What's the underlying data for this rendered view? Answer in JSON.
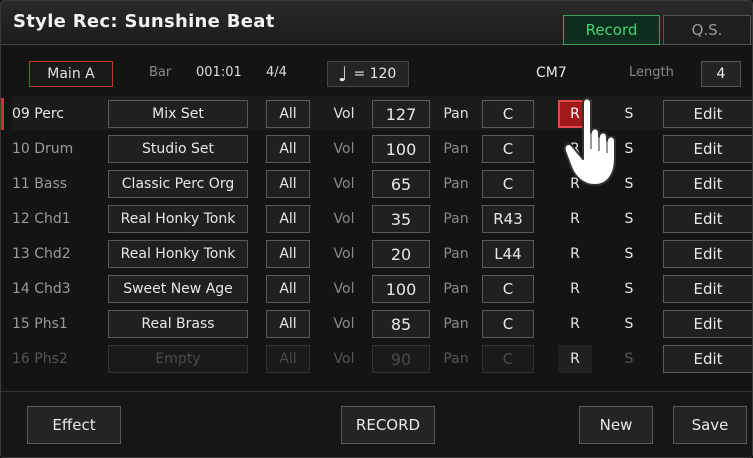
{
  "header": {
    "title": "Style Rec: Sunshine Beat",
    "tabs": [
      {
        "label": "Record",
        "active": true
      },
      {
        "label": "Q.S.",
        "active": false
      }
    ]
  },
  "info": {
    "section": "Main A",
    "bar_label": "Bar",
    "bar_value": "001:01",
    "time_signature": "4/4",
    "tempo_icon": "quarter-note-icon",
    "tempo_text": "= 120",
    "chord": "CM7",
    "length_label": "Length",
    "length_value": "4"
  },
  "tracks": [
    {
      "name": "09 Perc",
      "voice": "Mix Set",
      "all": "All",
      "vol_label": "Vol",
      "vol": "127",
      "pan_label": "Pan",
      "pan": "C",
      "r": "R",
      "s": "S",
      "edit": "Edit"
    },
    {
      "name": "10 Drum",
      "voice": "Studio Set",
      "all": "All",
      "vol_label": "Vol",
      "vol": "100",
      "pan_label": "Pan",
      "pan": "C",
      "r": "R",
      "s": "S",
      "edit": "Edit"
    },
    {
      "name": "11 Bass",
      "voice": "Classic Perc Org",
      "all": "All",
      "vol_label": "Vol",
      "vol": "65",
      "pan_label": "Pan",
      "pan": "C",
      "r": "R",
      "s": "S",
      "edit": "Edit"
    },
    {
      "name": "12 Chd1",
      "voice": "Real Honky Tonk",
      "all": "All",
      "vol_label": "Vol",
      "vol": "35",
      "pan_label": "Pan",
      "pan": "R43",
      "r": "R",
      "s": "S",
      "edit": "Edit"
    },
    {
      "name": "13 Chd2",
      "voice": "Real Honky Tonk",
      "all": "All",
      "vol_label": "Vol",
      "vol": "20",
      "pan_label": "Pan",
      "pan": "L44",
      "r": "R",
      "s": "S",
      "edit": "Edit"
    },
    {
      "name": "14 Chd3",
      "voice": "Sweet New Age",
      "all": "All",
      "vol_label": "Vol",
      "vol": "100",
      "pan_label": "Pan",
      "pan": "C",
      "r": "R",
      "s": "S",
      "edit": "Edit"
    },
    {
      "name": "15 Phs1",
      "voice": "Real Brass",
      "all": "All",
      "vol_label": "Vol",
      "vol": "85",
      "pan_label": "Pan",
      "pan": "C",
      "r": "R",
      "s": "S",
      "edit": "Edit"
    },
    {
      "name": "16 Phs2",
      "voice": "Empty",
      "all": "All",
      "vol_label": "Vol",
      "vol": "90",
      "pan_label": "Pan",
      "pan": "C",
      "r": "R",
      "s": "S",
      "edit": "Edit"
    }
  ],
  "footer": {
    "effect": "Effect",
    "record": "RECORD",
    "new": "New",
    "save": "Save"
  },
  "colors": {
    "accent_green": "#45d27a",
    "record_red": "#a11a1a",
    "selection_red": "#c0392b"
  }
}
